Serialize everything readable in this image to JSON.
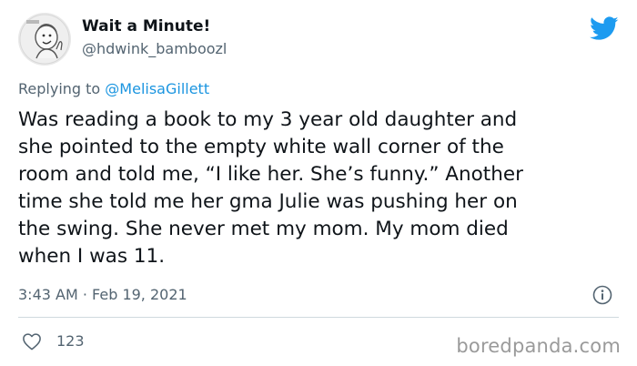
{
  "author": {
    "display_name": "Wait a Minute!",
    "handle": "@hdwink_bamboozl",
    "avatar_icon": "cartoon-avatar-icon"
  },
  "brand": {
    "icon": "twitter-bird-icon",
    "color": "#1d9bf0"
  },
  "reply": {
    "prefix": "Replying to ",
    "mention": "@MelisaGillett"
  },
  "tweet": {
    "lines": [
      "Was reading a book to my 3 year old daughter and",
      "she pointed to the empty white wall corner of the",
      "room and told me, “I like her. She’s funny.” Another",
      "time she told me her gma Julie was pushing her on",
      "the swing. She never met my mom. My mom died",
      "when I was 11."
    ],
    "timestamp": "3:43 AM · Feb 19, 2021",
    "info_icon": "info-icon"
  },
  "actions": {
    "like_icon": "heart-icon",
    "like_count": "123"
  },
  "watermark": "boredpanda.com",
  "colors": {
    "text": "#0f1419",
    "secondary": "#536471",
    "link": "#1b95e0",
    "divider": "#cfd9de"
  }
}
